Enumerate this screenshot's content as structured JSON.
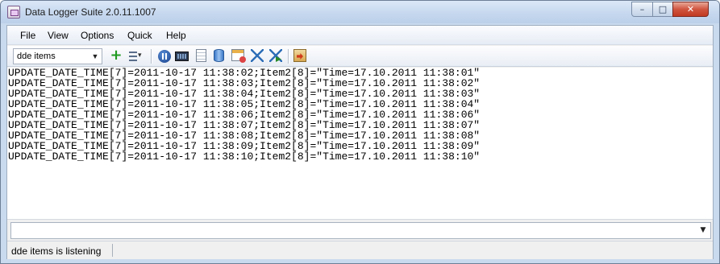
{
  "window": {
    "title": "Data Logger Suite 2.0.11.1007",
    "controls": {
      "minimize": "–",
      "maximize": "□",
      "close": "✕"
    }
  },
  "menu": [
    {
      "label": "File"
    },
    {
      "label": "View"
    },
    {
      "label": "Options"
    },
    {
      "label": "Quick"
    },
    {
      "label": "Help"
    }
  ],
  "toolbar": {
    "source_select": {
      "value": "dde items"
    },
    "buttons": [
      "add-icon",
      "columns-menu-icon",
      "pause-icon",
      "monitor-icon",
      "document-icon",
      "database-icon",
      "schedule-icon",
      "filter-icon",
      "filter-apply-icon",
      "export-icon"
    ]
  },
  "log": {
    "lines": [
      "UPDATE_DATE_TIME[7]=2011-10-17 11:38:02;Item2[8]=\"Time=17.10.2011 11:38:01\"",
      "UPDATE_DATE_TIME[7]=2011-10-17 11:38:03;Item2[8]=\"Time=17.10.2011 11:38:02\"",
      "UPDATE_DATE_TIME[7]=2011-10-17 11:38:04;Item2[8]=\"Time=17.10.2011 11:38:03\"",
      "UPDATE_DATE_TIME[7]=2011-10-17 11:38:05;Item2[8]=\"Time=17.10.2011 11:38:04\"",
      "UPDATE_DATE_TIME[7]=2011-10-17 11:38:06;Item2[8]=\"Time=17.10.2011 11:38:06\"",
      "UPDATE_DATE_TIME[7]=2011-10-17 11:38:07;Item2[8]=\"Time=17.10.2011 11:38:07\"",
      "UPDATE_DATE_TIME[7]=2011-10-17 11:38:08;Item2[8]=\"Time=17.10.2011 11:38:08\"",
      "UPDATE_DATE_TIME[7]=2011-10-17 11:38:09;Item2[8]=\"Time=17.10.2011 11:38:09\"",
      "UPDATE_DATE_TIME[7]=2011-10-17 11:38:10;Item2[8]=\"Time=17.10.2011 11:38:10\""
    ]
  },
  "command": {
    "value": ""
  },
  "status": {
    "text": "dde items is listening"
  }
}
